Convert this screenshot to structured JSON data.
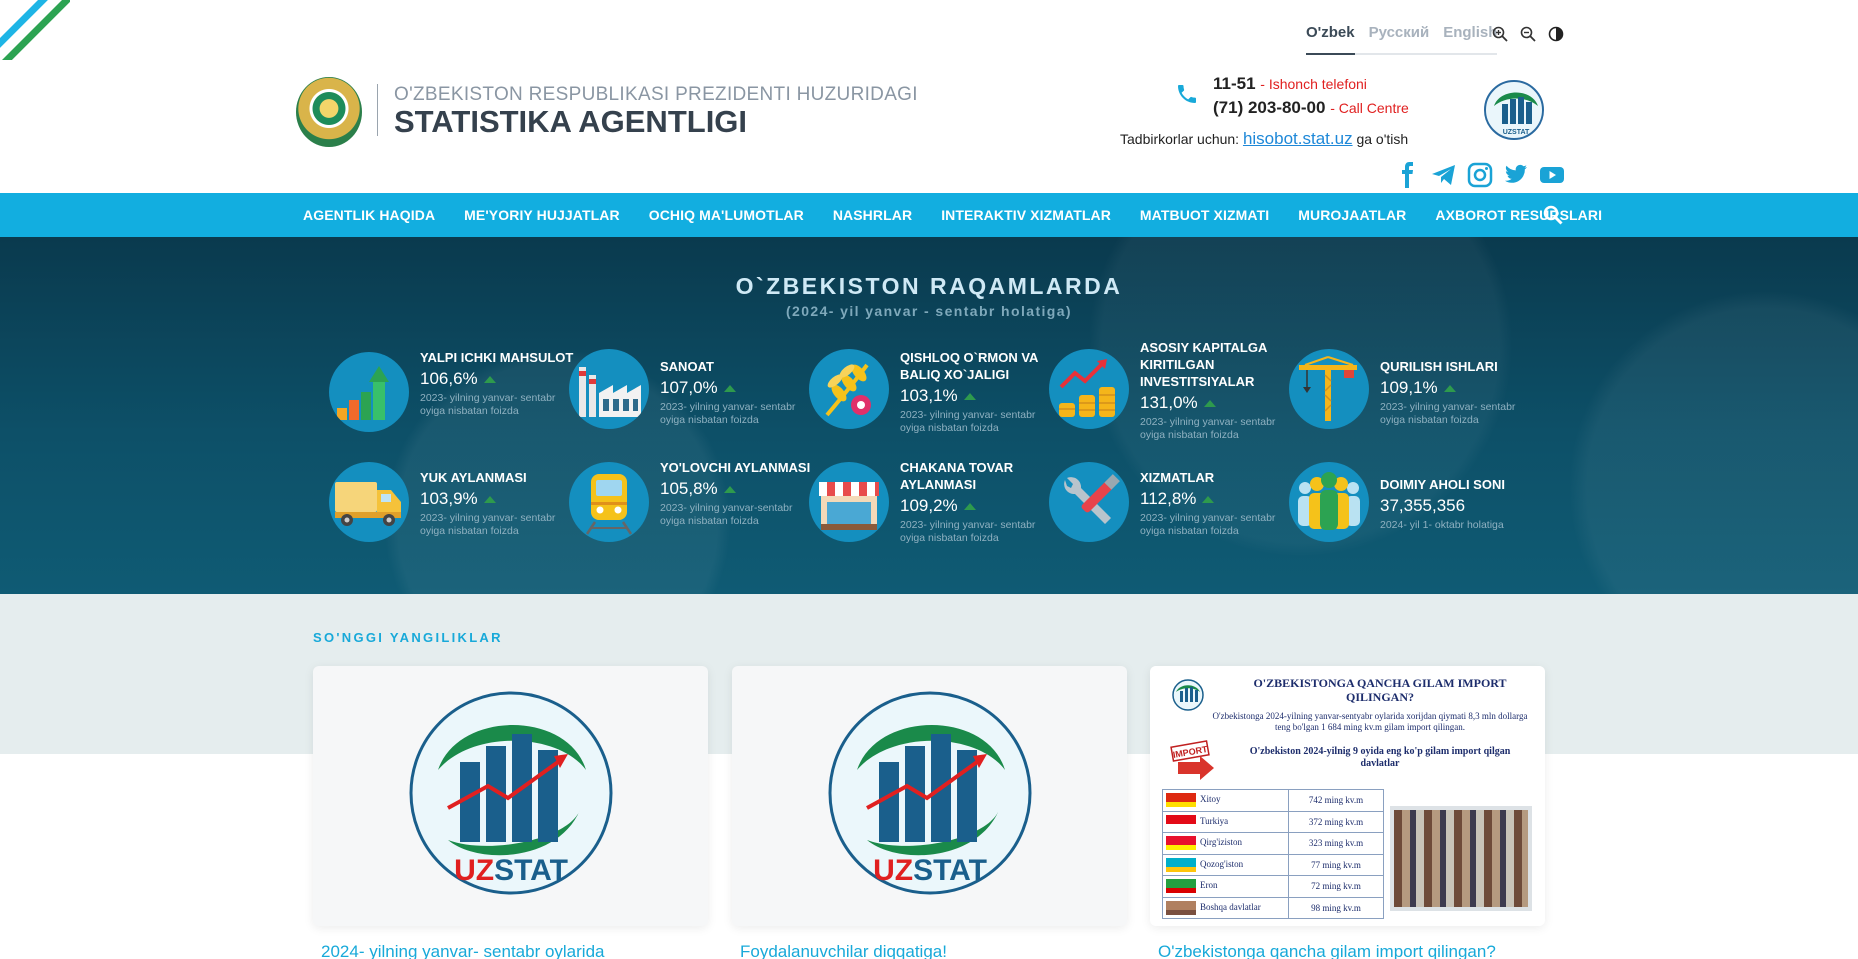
{
  "colors": {
    "nav_bg": "#12aee0",
    "stats_bg": "#0d5068",
    "accent_red": "#e02020",
    "link_blue": "#1e88d8",
    "uzstat_blue": "#1a5f8c",
    "uzstat_green": "#1a8a4a"
  },
  "languages": [
    "O'zbek",
    "Русский",
    "English"
  ],
  "active_language": "O'zbek",
  "tools": [
    "zoom-in-icon",
    "zoom-out-icon",
    "contrast-icon"
  ],
  "brand": {
    "top": "O'ZBEKISTON RESPUBLIKASI PREZIDENTI HUZURIDAGI",
    "main": "STATISTIKA AGENTLIGI"
  },
  "contact": {
    "phone1": "11-51",
    "phone1_label": "- Ishonch telefoni",
    "phone2": "(71) 203-80-00",
    "phone2_label": "- Call Centre",
    "biz_prefix": "Tadbirkorlar uchun:",
    "biz_link": "hisobot.stat.uz",
    "biz_suffix": "ga o'tish"
  },
  "social": [
    "facebook-icon",
    "telegram-icon",
    "instagram-icon",
    "twitter-icon",
    "youtube-icon"
  ],
  "uzstat_logo_text": "UZSTAT",
  "nav": [
    "AGENTLIK HAQIDA",
    "ME'YORIY HUJJATLAR",
    "OCHIQ MA'LUMOTLAR",
    "NASHRLAR",
    "INTERAKTIV XIZMATLAR",
    "MATBUOT XIZMATI",
    "MUROJAATLAR",
    "AXBOROT RESURSLARI"
  ],
  "stats": {
    "title": "O`ZBEKISTON RAQAMLARDA",
    "subtitle": "(2024- yil yanvar - sentabr holatiga)",
    "items": [
      {
        "name": "YALPI ICHKI MAHSULOT",
        "value": "106,6%",
        "note": "2023- yilning yanvar- sentabr oyiga nisbatan foizda",
        "icon": "growth-chart-icon"
      },
      {
        "name": "SANOAT",
        "value": "107,0%",
        "note": "2023- yilning yanvar- sentabr oyiga nisbatan foizda",
        "icon": "factory-icon"
      },
      {
        "name": "QISHLOQ O`RMON VA BALIQ XO`JALIGI",
        "value": "103,1%",
        "note": "2023- yilning yanvar- sentabr oyiga nisbatan foizda",
        "icon": "wheat-icon"
      },
      {
        "name": "ASOSIY KAPITALGA KIRITILGAN INVESTITSIYALAR",
        "value": "131,0%",
        "note": "2023- yilning yanvar- sentabr oyiga nisbatan foizda",
        "icon": "coins-chart-icon"
      },
      {
        "name": "QURILISH ISHLARI",
        "value": "109,1%",
        "note": "2023- yilning yanvar- sentabr oyiga nisbatan foizda",
        "icon": "crane-icon"
      },
      {
        "name": "YUK AYLANMASI",
        "value": "103,9%",
        "note": "2023- yilning yanvar- sentabr oyiga nisbatan foizda",
        "icon": "truck-icon"
      },
      {
        "name": "YO'LOVCHI AYLANMASI",
        "value": "105,8%",
        "note": "2023- yilning yanvar-sentabr oyiga nisbatan foizda",
        "icon": "train-icon"
      },
      {
        "name": "CHAKANA TOVAR AYLANMASI",
        "value": "109,2%",
        "note": "2023- yilning yanvar- sentabr oyiga nisbatan foizda",
        "icon": "shop-icon"
      },
      {
        "name": "XIZMATLAR",
        "value": "112,8%",
        "note": "2023- yilning yanvar- sentabr oyiga nisbatan foizda",
        "icon": "tools-icon"
      },
      {
        "name": "DOIMIY AHOLI SONI",
        "value": "37,355,356",
        "note": "2024- yil 1- oktabr holatiga",
        "icon": "people-icon"
      }
    ]
  },
  "news": {
    "title": "SO'NGGI YANGILIKLAR",
    "cards": [
      {
        "title": "2024- yilning yanvar- sentabr oylarida"
      },
      {
        "title": "Foydalanuvchilar diqqatiga!"
      },
      {
        "title": "O'zbekistonga qancha gilam import qilingan?"
      }
    ]
  },
  "infographic": {
    "title": "O'ZBEKISTONGA QANCHA GILAM IMPORT QILINGAN?",
    "desc": "O'zbekistonga 2024-yilning yanvar-sentyabr oylarida xorijdan qiymati 8,3 mln dollarga teng bo'lgan 1 684 ming kv.m gilam import qilingan.",
    "sub": "O'zbekiston 2024-yilnig 9 oyida eng ko'p gilam import qilgan davlatlar",
    "badge": "IMPORT",
    "rows": [
      {
        "country": "Xitoy",
        "value": "742 ming kv.m",
        "flag": [
          "#de2910",
          "#ffde00"
        ]
      },
      {
        "country": "Turkiya",
        "value": "372 ming kv.m",
        "flag": [
          "#e30a17",
          "#ffffff"
        ]
      },
      {
        "country": "Qirg'iziston",
        "value": "323 ming kv.m",
        "flag": [
          "#e8112d",
          "#ffef00"
        ]
      },
      {
        "country": "Qozog'iston",
        "value": "77 ming kv.m",
        "flag": [
          "#00afca",
          "#fec50c"
        ]
      },
      {
        "country": "Eron",
        "value": "72 ming kv.m",
        "flag": [
          "#239f40",
          "#da0000"
        ]
      },
      {
        "country": "Boshqa davlatlar",
        "value": "98 ming kv.m",
        "flag": [
          "#b08060",
          "#7a5040"
        ]
      }
    ]
  }
}
